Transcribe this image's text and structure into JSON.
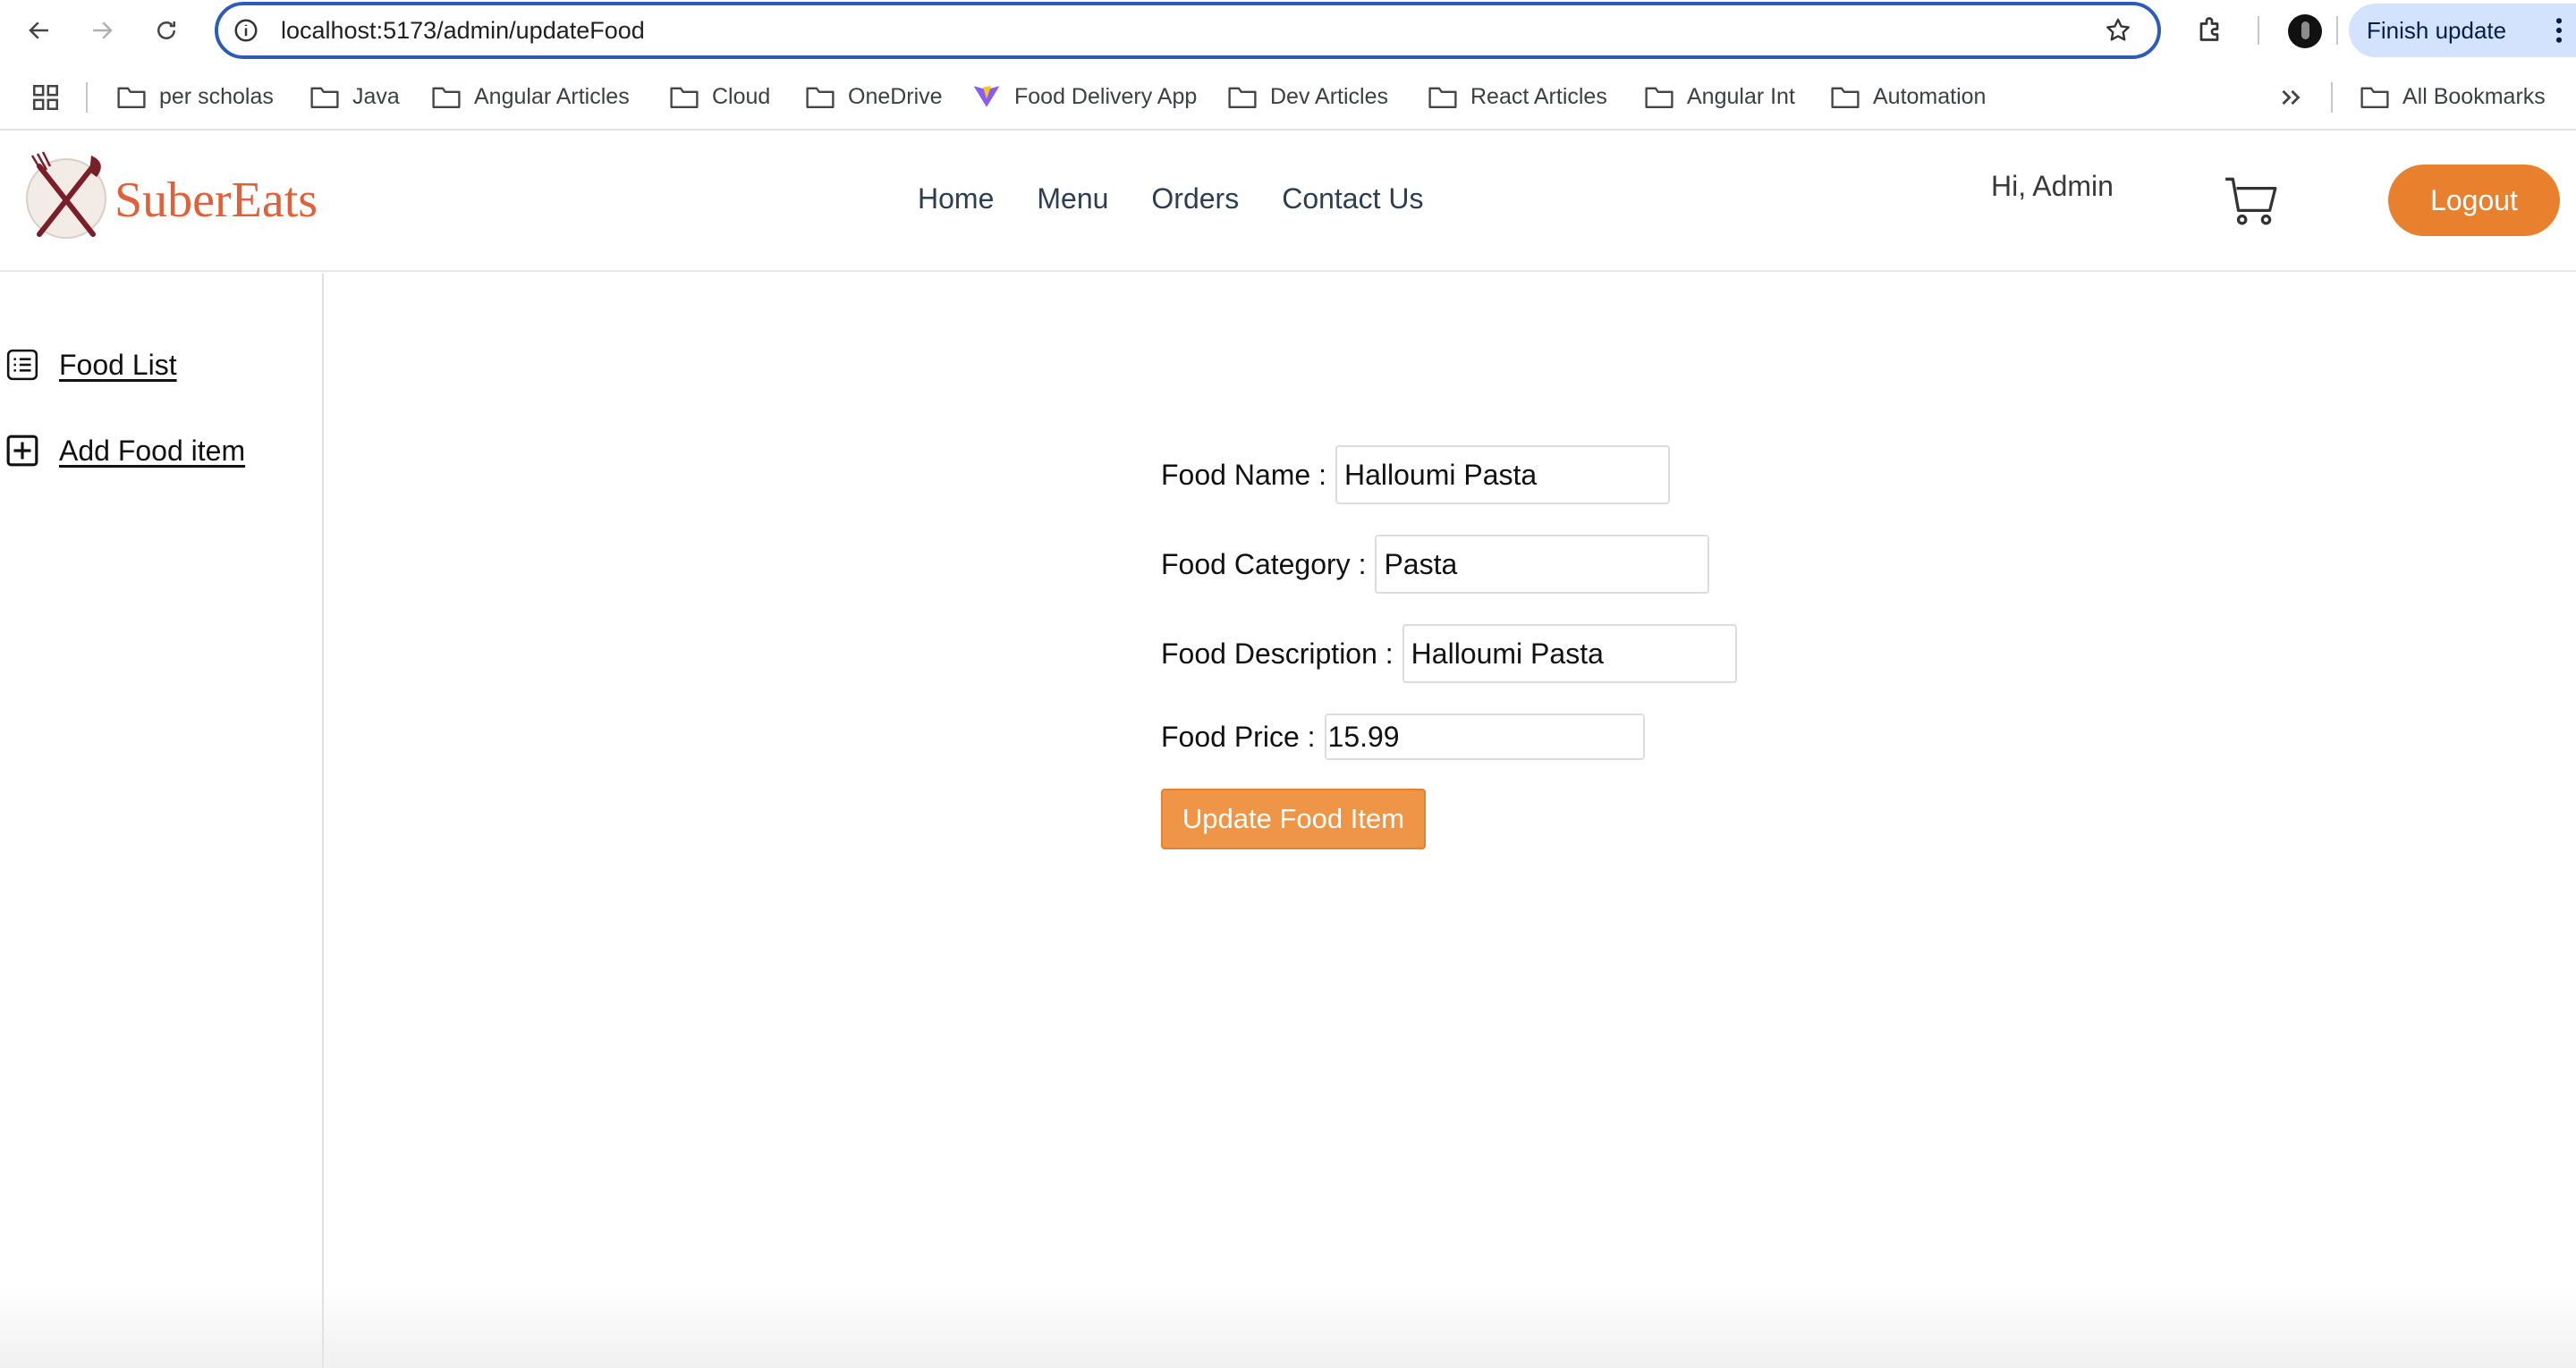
{
  "browser": {
    "url": "localhost:5173/admin/updateFood",
    "finish_update_label": "Finish update",
    "bookmarks": [
      {
        "label": "per scholas",
        "icon": "folder-icon"
      },
      {
        "label": "Java",
        "icon": "folder-icon"
      },
      {
        "label": "Angular Articles",
        "icon": "folder-icon"
      },
      {
        "label": "Cloud",
        "icon": "folder-icon"
      },
      {
        "label": "OneDrive",
        "icon": "folder-icon"
      },
      {
        "label": "Food Delivery App",
        "icon": "vite-icon"
      },
      {
        "label": "Dev Articles",
        "icon": "folder-icon"
      },
      {
        "label": "React Articles",
        "icon": "folder-icon"
      },
      {
        "label": "Angular Int",
        "icon": "folder-icon"
      },
      {
        "label": "Automation",
        "icon": "folder-icon"
      }
    ],
    "all_bookmarks_label": "All Bookmarks",
    "accent_color": "#2d5bb5"
  },
  "header": {
    "brand": "SuberEats",
    "brand_color": "#e0603a",
    "nav": [
      "Home",
      "Menu",
      "Orders",
      "Contact Us"
    ],
    "greeting": "Hi, Admin",
    "logout_label": "Logout",
    "logout_color": "#e8802e"
  },
  "sidebar": {
    "items": [
      {
        "label": "Food List",
        "icon": "list-icon"
      },
      {
        "label": "Add Food item",
        "icon": "plus-square-icon"
      }
    ]
  },
  "form": {
    "name_label": "Food Name :",
    "name_value": "Halloumi Pasta",
    "category_label": "Food Category :",
    "category_value": "Pasta",
    "description_label": "Food Description :",
    "description_value": "Halloumi Pasta",
    "price_label": "Food Price :",
    "price_value": "15.99",
    "submit_label": "Update Food Item",
    "submit_color": "#ef9548"
  }
}
